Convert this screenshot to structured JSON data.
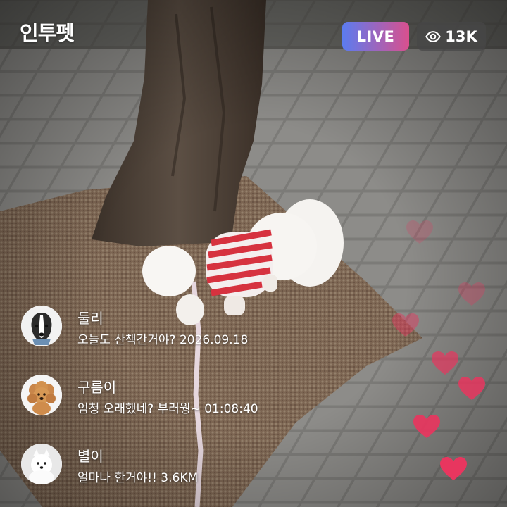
{
  "app": {
    "title": "인투펫"
  },
  "live": {
    "label": "LIVE",
    "viewer_count": "13K"
  },
  "comments": [
    {
      "name": "둘리",
      "text": "오늘도 산책간거야? 2026.09.18",
      "avatar": "border-collie-dog"
    },
    {
      "name": "구름이",
      "text": "엄청 오래했네? 부러웡~ 01:08:40",
      "avatar": "brown-poodle-dog"
    },
    {
      "name": "별이",
      "text": "얼마나 한거야!! 3.6KM",
      "avatar": "white-spitz-dog"
    }
  ],
  "colors": {
    "live_gradient_start": "#5b7cf0",
    "live_gradient_end": "#d9508e",
    "heart": "#e8365f"
  },
  "icons": {
    "viewers": "eye-icon",
    "reaction": "heart-icon"
  }
}
